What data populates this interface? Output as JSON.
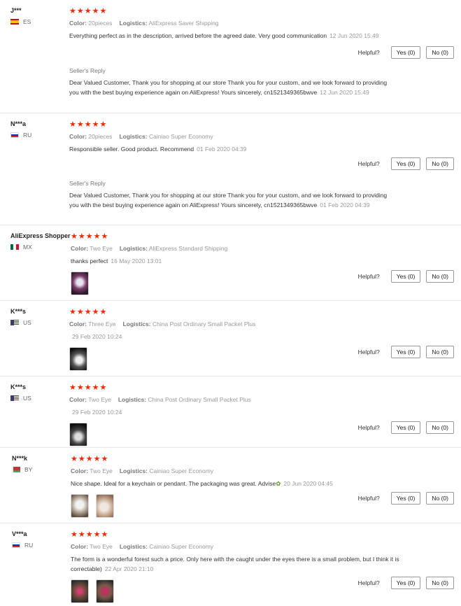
{
  "helpful_label": "Helpful?",
  "seller_reply_title": "Seller's Reply",
  "color_label": "Color:",
  "logistics_label": "Logistics:",
  "stars": "★★★★★",
  "reviews": [
    {
      "user": "J***",
      "country": "ES",
      "rating": 5,
      "color": "20pieces",
      "logistics": "AliExpress Saver Shipping",
      "text": "Everything perfect as in the description, arrived before the agreed date. Very good communication",
      "date": "12 Jun 2020 15:49",
      "yes": "Yes (0)",
      "no": "No (0)",
      "reply": "Dear Valued Customer, Thank you for shopping at our store Thank you for your custom, and we look forward to providing you with the best buying experience again on AliExpress! Yours sincerely, cn1521349365bwve",
      "reply_date": "12 Jun 2020 15:49"
    },
    {
      "user": "N***a",
      "country": "RU",
      "rating": 5,
      "color": "20pieces",
      "logistics": "Cainiao Super Economy",
      "text": "Responsible seller. Good product. Recommend",
      "date": "01 Feb 2020 04:39",
      "yes": "Yes (0)",
      "no": "No (0)",
      "reply": "Dear Valued Customer, Thank you for shopping at our store Thank you for your custom, and we look forward to providing you with the best buying experience again on AliExpress! Yours sincerely, cn1521349365bwve",
      "reply_date": "01 Feb 2020 04:39"
    },
    {
      "user": "AliExpress Shopper",
      "country": "MX",
      "rating": 5,
      "color": "Two Eye",
      "logistics": "AliExpress Standard Shipping",
      "text": "thanks perfect",
      "date": "16 May 2020 13:01",
      "yes": "Yes (0)",
      "no": "No (0)"
    },
    {
      "user": "K***s",
      "country": "US",
      "rating": 5,
      "color": "Three Eye",
      "logistics": "China Post Ordinary Small Packet Plus",
      "text": "",
      "date": "29 Feb 2020 10:24",
      "yes": "Yes (0)",
      "no": "No (0)"
    },
    {
      "user": "K***s",
      "country": "US",
      "rating": 5,
      "color": "Two Eye",
      "logistics": "China Post Ordinary Small Packet Plus",
      "text": "",
      "date": "29 Feb 2020 10:24",
      "yes": "Yes (0)",
      "no": "No (0)"
    },
    {
      "user": "N***k",
      "country": "BY",
      "rating": 5,
      "color": "Two Eye",
      "logistics": "Cainiao Super Economy",
      "text": "Nice shape. Ideal for a keychain or pendant. The packaging was great. Advise",
      "date": "20 Jun 2020 04:45",
      "yes": "Yes (0)",
      "no": "No (0)"
    },
    {
      "user": "V***a",
      "country": "RU",
      "rating": 5,
      "color": "Two Eye",
      "logistics": "Cainiao Super Economy",
      "text": "The form is a wonderful forest such a price. Only here with the caught under the eyes there is a small problem, but I think it is correctable)",
      "date": "22 Apr 2020 21:10",
      "yes": "Yes (0)",
      "no": "No (0)"
    }
  ],
  "colors": {
    "star": "#e62e04",
    "muted": "#999999",
    "border": "#e8e8e8"
  }
}
